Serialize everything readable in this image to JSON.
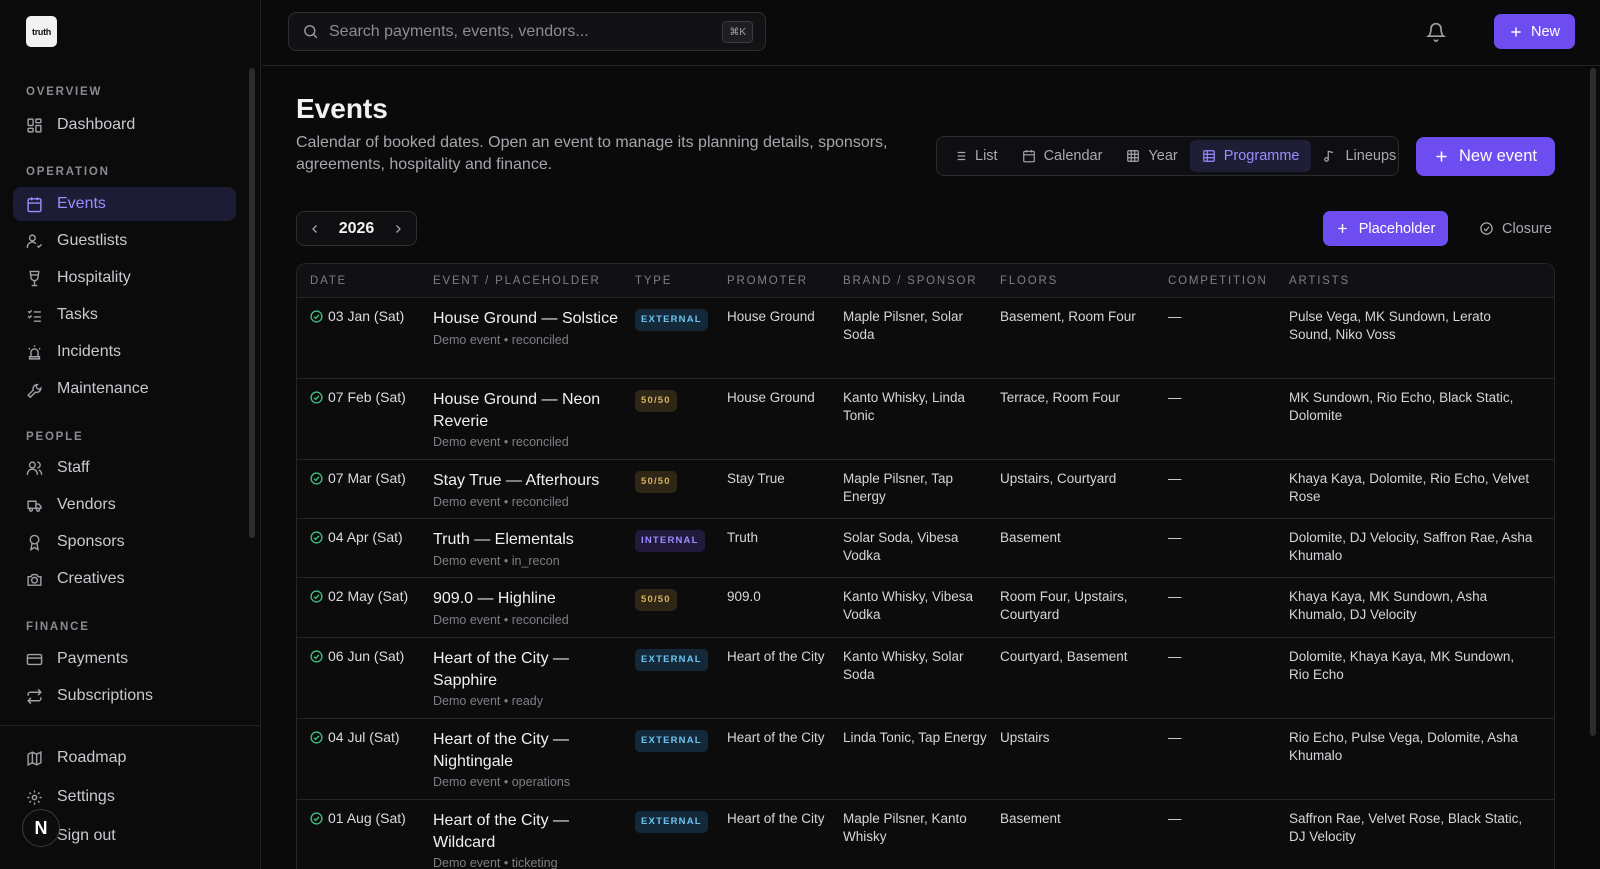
{
  "brand": {
    "logo_text": "truth"
  },
  "sidebar": {
    "sections": {
      "overview": "OVERVIEW",
      "operation": "OPERATION",
      "people": "PEOPLE",
      "finance": "FINANCE"
    },
    "items": {
      "dashboard": "Dashboard",
      "events": "Events",
      "guestlists": "Guestlists",
      "hospitality": "Hospitality",
      "tasks": "Tasks",
      "incidents": "Incidents",
      "maintenance": "Maintenance",
      "staff": "Staff",
      "vendors": "Vendors",
      "sponsors": "Sponsors",
      "creatives": "Creatives",
      "payments": "Payments",
      "subscriptions": "Subscriptions",
      "roadmap": "Roadmap",
      "settings": "Settings",
      "signout": "Sign out"
    },
    "active": "events",
    "avatar_initial": "N"
  },
  "topbar": {
    "search_placeholder": "Search payments, events, vendors...",
    "shortcut": "⌘K",
    "new_label": "New"
  },
  "page": {
    "title": "Events",
    "description": "Calendar of booked dates. Open an event to manage its planning details, sponsors, agreements, hospitality and finance.",
    "views": {
      "list": "List",
      "calendar": "Calendar",
      "year": "Year",
      "programme": "Programme",
      "lineups": "Lineups"
    },
    "active_view": "programme",
    "new_event_label": "New event",
    "year": "2026",
    "placeholder_label": "Placeholder",
    "closure_label": "Closure"
  },
  "table": {
    "headers": {
      "date": "DATE",
      "event": "EVENT / PLACEHOLDER",
      "type": "TYPE",
      "promoter": "PROMOTER",
      "brand": "BRAND / SPONSOR",
      "floors": "FLOORS",
      "competition": "COMPETITION",
      "artists": "ARTISTS"
    },
    "rows": [
      {
        "date": "03 Jan (Sat)",
        "title": "House Ground — Solstice",
        "sub": "Demo event • reconciled",
        "type": "EXTERNAL",
        "promoter": "House Ground",
        "brand": "Maple Pilsner, Solar Soda",
        "floors": "Basement, Room Four",
        "competition": "—",
        "artists": "Pulse Vega, MK Sundown, Lerato Sound, Niko Voss"
      },
      {
        "date": "07 Feb (Sat)",
        "title": "House Ground — Neon Reverie",
        "sub": "Demo event • reconciled",
        "type": "50/50",
        "promoter": "House Ground",
        "brand": "Kanto Whisky, Linda Tonic",
        "floors": "Terrace, Room Four",
        "competition": "—",
        "artists": "MK Sundown, Rio Echo, Black Static, Dolomite"
      },
      {
        "date": "07 Mar (Sat)",
        "title": "Stay True — Afterhours",
        "sub": "Demo event • reconciled",
        "type": "50/50",
        "promoter": "Stay True",
        "brand": "Maple Pilsner, Tap Energy",
        "floors": "Upstairs, Courtyard",
        "competition": "—",
        "artists": "Khaya Kaya, Dolomite, Rio Echo, Velvet Rose"
      },
      {
        "date": "04 Apr (Sat)",
        "title": "Truth — Elementals",
        "sub": "Demo event • in_recon",
        "type": "INTERNAL",
        "promoter": "Truth",
        "brand": "Solar Soda, Vibesa Vodka",
        "floors": "Basement",
        "competition": "—",
        "artists": "Dolomite, DJ Velocity, Saffron Rae, Asha Khumalo"
      },
      {
        "date": "02 May (Sat)",
        "title": "909.0 — Highline",
        "sub": "Demo event • reconciled",
        "type": "50/50",
        "promoter": "909.0",
        "brand": "Kanto Whisky, Vibesa Vodka",
        "floors": "Room Four, Upstairs, Courtyard",
        "competition": "—",
        "artists": "Khaya Kaya, MK Sundown, Asha Khumalo, DJ Velocity"
      },
      {
        "date": "06 Jun (Sat)",
        "title": "Heart of the City — Sapphire",
        "sub": "Demo event • ready",
        "type": "EXTERNAL",
        "promoter": "Heart of the City",
        "brand": "Kanto Whisky, Solar Soda",
        "floors": "Courtyard, Basement",
        "competition": "—",
        "artists": "Dolomite, Khaya Kaya, MK Sundown, Rio Echo"
      },
      {
        "date": "04 Jul (Sat)",
        "title": "Heart of the City — Nightingale",
        "sub": "Demo event • operations",
        "type": "EXTERNAL",
        "promoter": "Heart of the City",
        "brand": "Linda Tonic, Tap Energy",
        "floors": "Upstairs",
        "competition": "—",
        "artists": "Rio Echo, Pulse Vega, Dolomite, Asha Khumalo"
      },
      {
        "date": "01 Aug (Sat)",
        "title": "Heart of the City — Wildcard",
        "sub": "Demo event • ticketing",
        "type": "EXTERNAL",
        "promoter": "Heart of the City",
        "brand": "Maple Pilsner, Kanto Whisky",
        "floors": "Basement",
        "competition": "—",
        "artists": "Saffron Rae, Velvet Rose, Black Static, DJ Velocity"
      }
    ]
  },
  "colors": {
    "accent": "#6d4cf0",
    "active_text": "#9d8cff",
    "check": "#3fbf7f"
  }
}
